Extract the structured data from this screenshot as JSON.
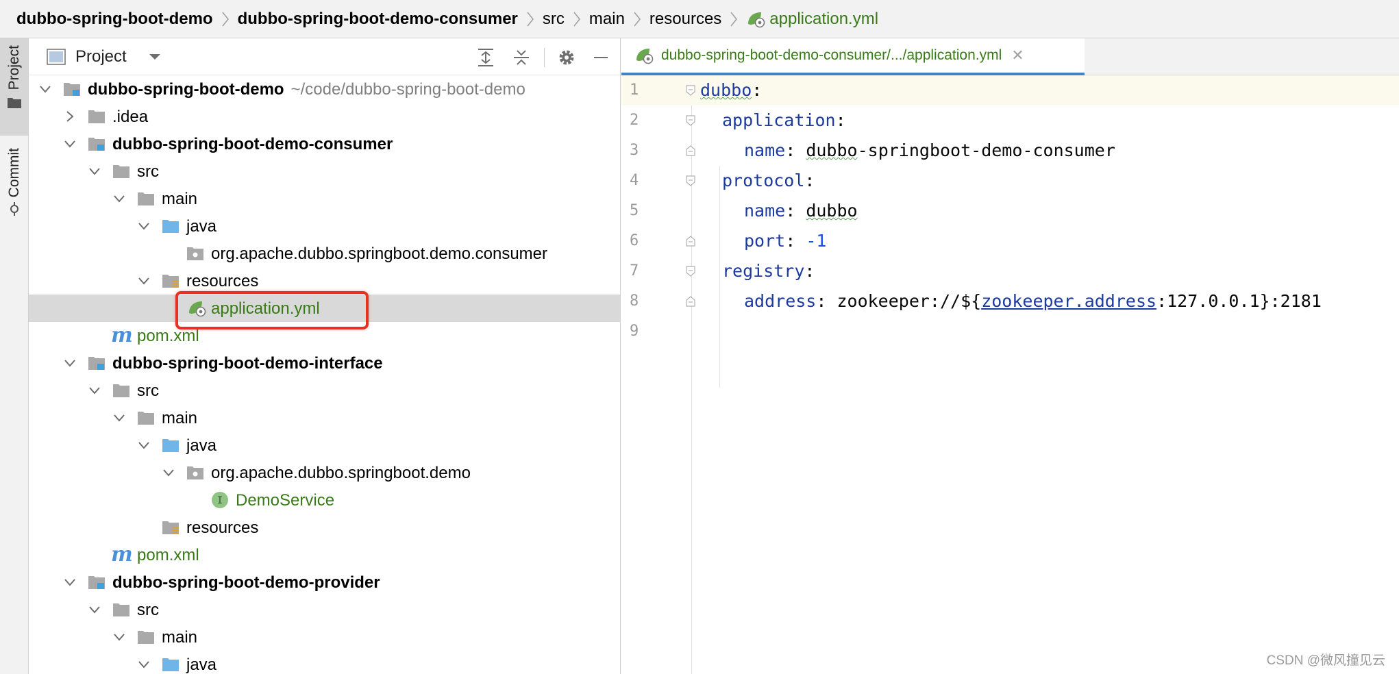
{
  "breadcrumb": {
    "items": [
      "dubbo-spring-boot-demo",
      "dubbo-spring-boot-demo-consumer",
      "src",
      "main",
      "resources",
      "application.yml"
    ]
  },
  "toolstrip": {
    "project_label": "Project",
    "commit_label": "Commit"
  },
  "project_panel": {
    "title": "Project",
    "root_path": "~/code/dubbo-spring-boot-demo",
    "tree": [
      {
        "label": "dubbo-spring-boot-demo",
        "icon": "module-folder-icon",
        "expanded": true
      },
      {
        "label": ".idea",
        "icon": "folder-icon",
        "expanded": false
      },
      {
        "label": "dubbo-spring-boot-demo-consumer",
        "icon": "module-folder-icon",
        "expanded": true
      },
      {
        "label": "src",
        "icon": "folder-icon",
        "expanded": true
      },
      {
        "label": "main",
        "icon": "folder-icon",
        "expanded": true
      },
      {
        "label": "java",
        "icon": "source-folder-icon",
        "expanded": true
      },
      {
        "label": "org.apache.dubbo.springboot.demo.consumer",
        "icon": "package-icon"
      },
      {
        "label": "resources",
        "icon": "resources-folder-icon",
        "expanded": true
      },
      {
        "label": "application.yml",
        "icon": "spring-yaml-icon",
        "selected": true
      },
      {
        "label": "pom.xml",
        "icon": "maven-icon"
      },
      {
        "label": "dubbo-spring-boot-demo-interface",
        "icon": "module-folder-icon",
        "expanded": true
      },
      {
        "label": "src",
        "icon": "folder-icon",
        "expanded": true
      },
      {
        "label": "main",
        "icon": "folder-icon",
        "expanded": true
      },
      {
        "label": "java",
        "icon": "source-folder-icon",
        "expanded": true
      },
      {
        "label": "org.apache.dubbo.springboot.demo",
        "icon": "package-icon",
        "expanded": true
      },
      {
        "label": "DemoService",
        "icon": "interface-icon"
      },
      {
        "label": "resources",
        "icon": "resources-folder-icon"
      },
      {
        "label": "pom.xml",
        "icon": "maven-icon"
      },
      {
        "label": "dubbo-spring-boot-demo-provider",
        "icon": "module-folder-icon",
        "expanded": true
      },
      {
        "label": "src",
        "icon": "folder-icon",
        "expanded": true
      },
      {
        "label": "main",
        "icon": "folder-icon",
        "expanded": true
      },
      {
        "label": "java",
        "icon": "source-folder-icon",
        "expanded": true
      }
    ]
  },
  "editor": {
    "tab_label": "dubbo-spring-boot-demo-consumer/.../application.yml",
    "line_numbers": [
      "1",
      "2",
      "3",
      "4",
      "5",
      "6",
      "7",
      "8",
      "9"
    ],
    "code": {
      "l1_key": "dubbo",
      "l1_colon": ":",
      "l2_key": "application",
      "l2_colon": ":",
      "l3_key": "name",
      "l3_sep": ": ",
      "l3_value_a": "dubbo",
      "l3_value_b": "-springboot-demo-consumer",
      "l4_key": "protocol",
      "l4_colon": ":",
      "l5_key": "name",
      "l5_sep": ": ",
      "l5_value": "dubbo",
      "l6_key": "port",
      "l6_sep": ": ",
      "l6_value": "-1",
      "l7_key": "registry",
      "l7_colon": ":",
      "l8_key": "address",
      "l8_sep": ": ",
      "l8_value_a": "zookeeper://${",
      "l8_value_link": "zookeeper.address",
      "l8_value_b": ":127.0.0.1}:2181"
    }
  },
  "watermark": "CSDN @微风撞见云",
  "colors": {
    "accent": "#4083c9",
    "file_green": "#397a18",
    "yaml_key": "#1d3a9e",
    "highlight_red": "#e53323"
  }
}
